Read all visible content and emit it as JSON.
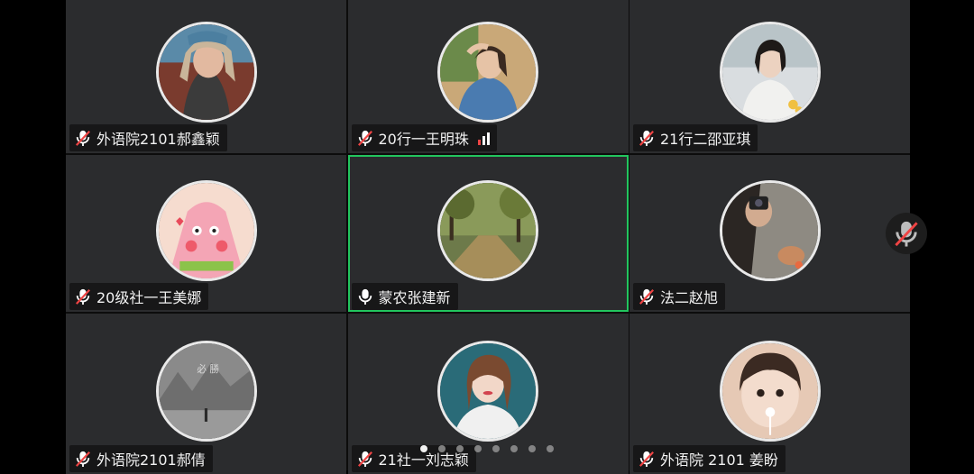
{
  "participants": [
    {
      "name": "外语院2101郝鑫颖",
      "muted": true,
      "avatar": "avatar-person-headscarf",
      "avatar_bg": "#b98b6a"
    },
    {
      "name": "20行一王明珠",
      "muted": true,
      "avatar": "avatar-person-street",
      "avatar_bg": "#c9a878",
      "signal": true
    },
    {
      "name": "21行二邵亚琪",
      "muted": true,
      "avatar": "avatar-person-flowers",
      "avatar_bg": "#d9dde0"
    },
    {
      "name": "20级社一王美娜",
      "muted": true,
      "avatar": "avatar-patrick-star",
      "avatar_bg": "#f6dccf"
    },
    {
      "name": "蒙农张建新",
      "muted": false,
      "avatar": "avatar-tree-road",
      "avatar_bg": "#6d7a4a",
      "speaking": true
    },
    {
      "name": "法二赵旭",
      "muted": true,
      "avatar": "avatar-camera-selfie",
      "avatar_bg": "#8e8a82"
    },
    {
      "name": "外语院2101郝倩",
      "muted": true,
      "avatar": "avatar-gray-landscape",
      "avatar_bg": "#8a8a8a"
    },
    {
      "name": "21社一刘志颖",
      "muted": true,
      "avatar": "avatar-person-portrait",
      "avatar_bg": "#2a6b78"
    },
    {
      "name": "外语院 2101 姜盼",
      "muted": true,
      "avatar": "avatar-child-lollipop",
      "avatar_bg": "#e6c9b5"
    }
  ],
  "pagination": {
    "total": 8,
    "active": 0
  },
  "colors": {
    "tile_bg": "#2b2c2e",
    "speaking_border": "#22c55e",
    "muted_red": "#ef4444"
  }
}
